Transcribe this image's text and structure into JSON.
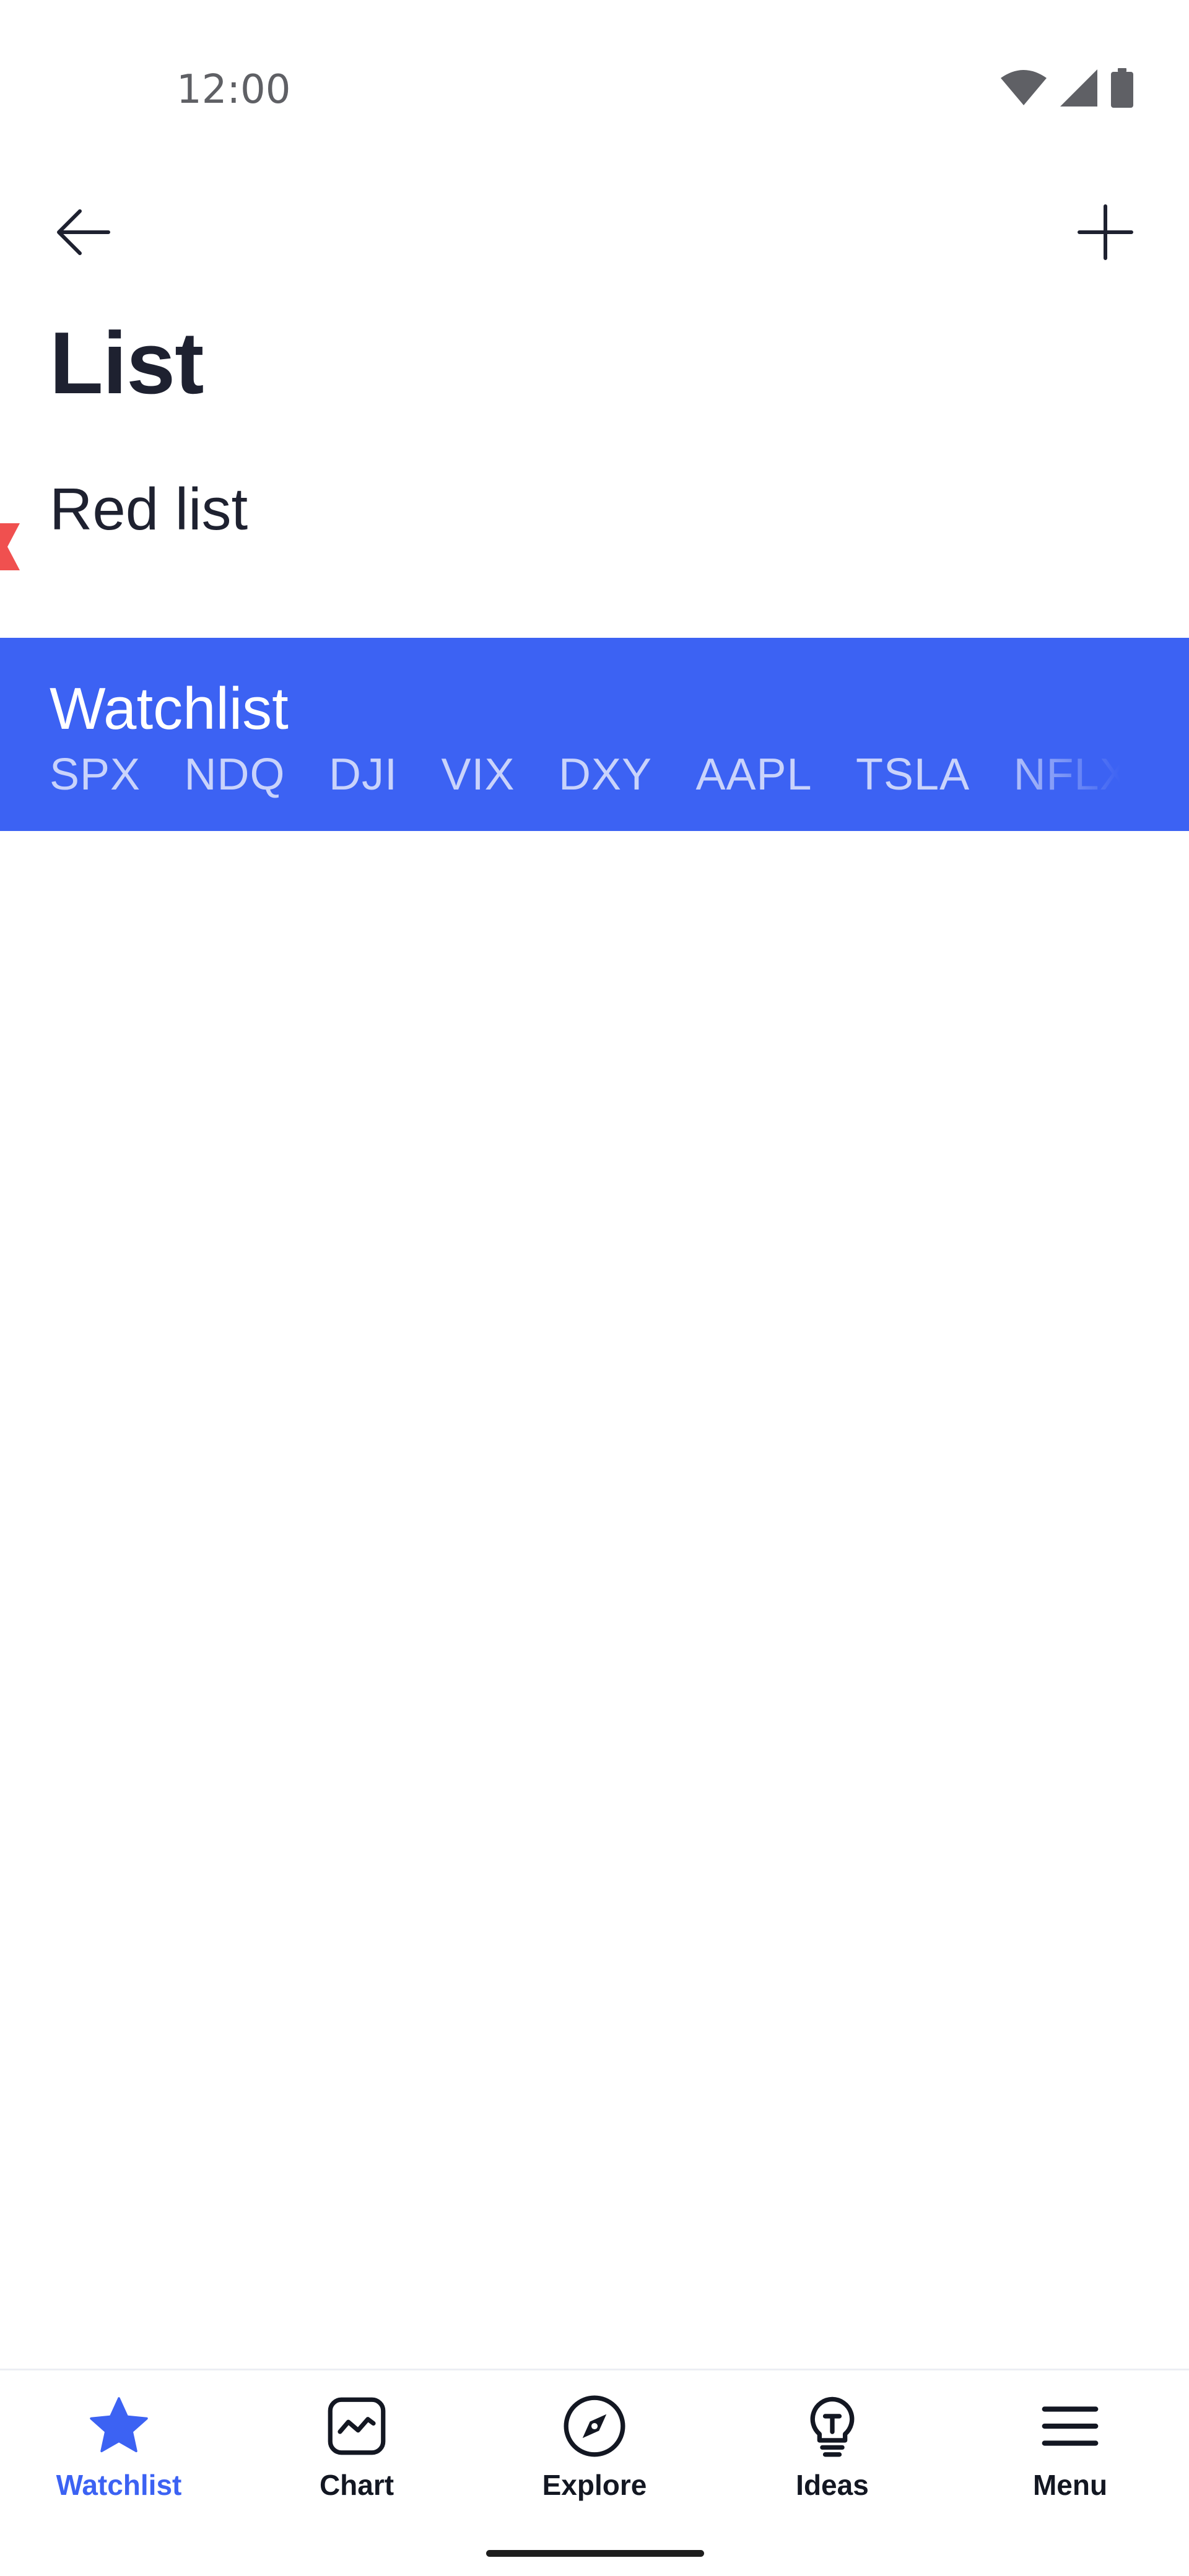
{
  "status_bar": {
    "time": "12:00",
    "icons": [
      "wifi-icon",
      "signal-icon",
      "battery-icon"
    ]
  },
  "app_bar": {
    "back_icon": "arrow-left-icon",
    "add_icon": "plus-icon"
  },
  "page": {
    "title": "List"
  },
  "lists": [
    {
      "name": "Red list",
      "flag_color": "#f0504f",
      "selected": false
    },
    {
      "name": "Watchlist",
      "selected": true,
      "tickers": [
        "SPX",
        "NDQ",
        "DJI",
        "VIX",
        "DXY",
        "AAPL",
        "TSLA",
        "NFLX"
      ]
    }
  ],
  "colors": {
    "accent": "#3c62f3",
    "text_primary": "#1e2130",
    "ticker_text": "#c9d3fb",
    "flag_red": "#f0504f"
  },
  "bottom_nav": {
    "items": [
      {
        "label": "Watchlist",
        "icon": "star-icon",
        "active": true
      },
      {
        "label": "Chart",
        "icon": "chart-icon",
        "active": false
      },
      {
        "label": "Explore",
        "icon": "compass-icon",
        "active": false
      },
      {
        "label": "Ideas",
        "icon": "lightbulb-icon",
        "active": false
      },
      {
        "label": "Menu",
        "icon": "menu-icon",
        "active": false
      }
    ]
  }
}
